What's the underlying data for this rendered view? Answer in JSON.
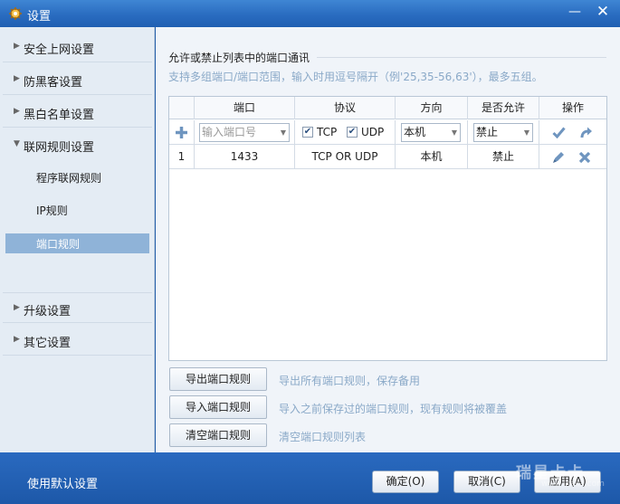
{
  "window": {
    "title": "设置",
    "minimize_glyph": "—",
    "close_glyph": "✕"
  },
  "sidebar": {
    "items": [
      {
        "label": "安全上网设置",
        "arrow": "▶"
      },
      {
        "label": "防黑客设置",
        "arrow": "▶"
      },
      {
        "label": "黑白名单设置",
        "arrow": "▶"
      },
      {
        "label": "联网规则设置",
        "arrow": "▼"
      },
      {
        "label": "升级设置",
        "arrow": "▶"
      },
      {
        "label": "其它设置",
        "arrow": "▶"
      }
    ],
    "subitems": [
      {
        "label": "程序联网规则"
      },
      {
        "label": "IP规则"
      },
      {
        "label": "端口规则"
      }
    ]
  },
  "content": {
    "section_title": "允许或禁止列表中的端口通讯",
    "hint": "支持多组端口/端口范围，输入时用逗号隔开（例'25,35-56,63'），最多五组。",
    "table": {
      "headers": [
        "端口",
        "协议",
        "方向",
        "是否允许",
        "操作"
      ],
      "input_row": {
        "port_placeholder": "输入端口号",
        "tcp_label": "TCP",
        "udp_label": "UDP",
        "direction_value": "本机",
        "allow_value": "禁止"
      },
      "rows": [
        {
          "index": "1",
          "port": "1433",
          "protocol": "TCP OR UDP",
          "direction": "本机",
          "allow": "禁止"
        }
      ]
    },
    "actions": [
      {
        "label": "导出端口规则",
        "hint": "导出所有端口规则，保存备用"
      },
      {
        "label": "导入端口规则",
        "hint": "导入之前保存过的端口规则，现有规则将被覆盖"
      },
      {
        "label": "清空端口规则",
        "hint": "清空端口规则列表"
      }
    ]
  },
  "footer": {
    "default_label": "使用默认设置",
    "ok_label": "确定(O)",
    "cancel_label": "取消(C)",
    "apply_label": "应用(A)",
    "watermark": "瑞星卡卡",
    "watermark_url": "www.ikaka.com"
  },
  "colors": {
    "accent": "#1f5aa6",
    "active_nav": "#8fb3d8",
    "hint_text": "#8aa9c8"
  }
}
